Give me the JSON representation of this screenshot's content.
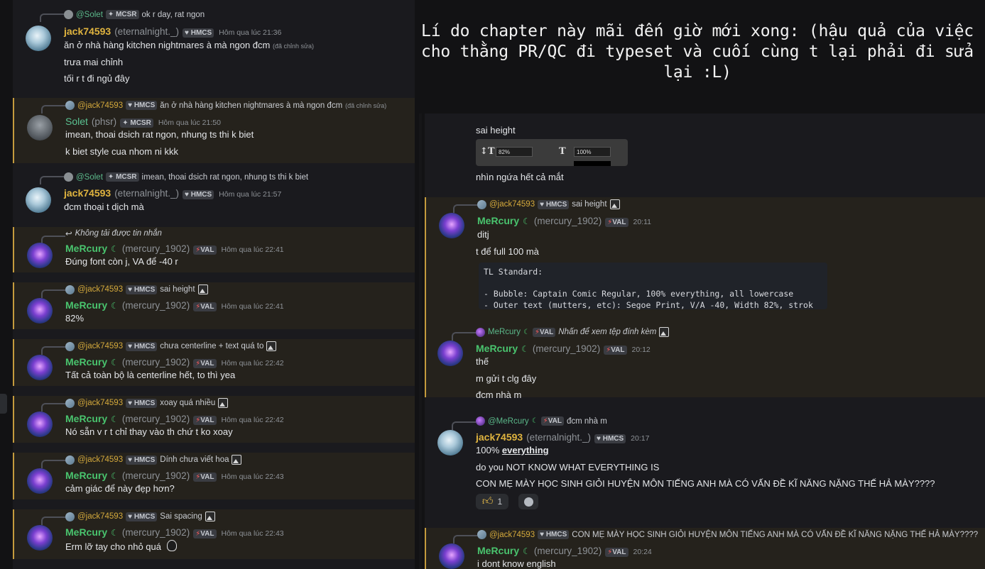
{
  "title": "Lí do chapter này mãi đến giờ mới xong: (hậu quả của việc cho thằng PR/QC đi typeset và cuối cùng t lại phải đi sửa lại :L)",
  "left_messages": [
    {
      "reply_name": "@Solet",
      "reply_tag": "MCSR",
      "reply_text": "ok r day, rat ngon",
      "author": "jack74593",
      "handle": "(eternalnight._)",
      "tag": "HMCS",
      "time": "Hôm qua lúc 21:36",
      "lines": [
        "ăn ở nhà hàng kitchen nightmares à mà ngon đcm",
        "trưa mai chỉnh",
        "tối r t đi ngủ đây"
      ],
      "edited": "(đã chỉnh sửa)"
    },
    {
      "reply_name": "@jack74593",
      "reply_tag": "HMCS",
      "reply_text": "ăn ở nhà hàng kitchen nightmares à mà ngon đcm",
      "reply_edited": "(đã chỉnh sửa)",
      "author": "Solet",
      "handle": "(phsr)",
      "tag": "MCSR",
      "time": "Hôm qua lúc 21:50",
      "lines": [
        "imean, thoai dsich rat ngon, nhung ts thi k biet",
        "k biet style cua nhom ni kkk"
      ]
    },
    {
      "reply_name": "@Solet",
      "reply_tag": "MCSR",
      "reply_text": "imean, thoai dsich rat ngon, nhung ts thi k biet",
      "author": "jack74593",
      "handle": "(eternalnight._)",
      "tag": "HMCS",
      "time": "Hôm qua lúc 21:57",
      "lines": [
        "đcm thoại t dịch mà"
      ]
    },
    {
      "reply_text": "Không tải được tin nhắn",
      "author": "MeRcury",
      "handle": "(mercury_1902)",
      "tag": "VAL",
      "time": "Hôm qua lúc 22:41",
      "lines": [
        "Đúng font còn j, VA để -40 r"
      ]
    },
    {
      "reply_name": "@jack74593",
      "reply_tag": "HMCS",
      "reply_text": "sai height",
      "author": "MeRcury",
      "handle": "(mercury_1902)",
      "tag": "VAL",
      "time": "Hôm qua lúc 22:41",
      "lines": [
        "82%"
      ]
    },
    {
      "reply_name": "@jack74593",
      "reply_tag": "HMCS",
      "reply_text": "chưa centerline + text quá to",
      "author": "MeRcury",
      "handle": "(mercury_1902)",
      "tag": "VAL",
      "time": "Hôm qua lúc 22:42",
      "lines": [
        "Tất cả toàn bộ là centerline hết, to thì yea"
      ]
    },
    {
      "reply_name": "@jack74593",
      "reply_tag": "HMCS",
      "reply_text": "xoay quá nhiều",
      "author": "MeRcury",
      "handle": "(mercury_1902)",
      "tag": "VAL",
      "time": "Hôm qua lúc 22:42",
      "lines": [
        "Nó sẵn v r t chỉ thay vào th chứ t ko xoay"
      ]
    },
    {
      "reply_name": "@jack74593",
      "reply_tag": "HMCS",
      "reply_text": "Dính chưa viết hoa",
      "author": "MeRcury",
      "handle": "(mercury_1902)",
      "tag": "VAL",
      "time": "Hôm qua lúc 22:43",
      "lines": [
        "cảm giác để này đẹp hơn?"
      ]
    },
    {
      "reply_name": "@jack74593",
      "reply_tag": "HMCS",
      "reply_text": "Sai spacing",
      "author": "MeRcury",
      "handle": "(mercury_1902)",
      "tag": "VAL",
      "time": "Hôm qua lúc 22:43",
      "lines": [
        "Erm lỡ tay cho nhỏ quá"
      ]
    }
  ],
  "right": {
    "top_lines": [
      "sai height",
      "nhìn ngứa hết cả mắt"
    ],
    "screenshot": {
      "val1": "82%",
      "val2": "100%"
    },
    "m1": {
      "reply_name": "@jack74593",
      "reply_tag": "HMCS",
      "reply_text": "sai height",
      "author": "MeRcury",
      "handle": "(mercury_1902)",
      "tag": "VAL",
      "time": "20:11",
      "lines": [
        "ditj",
        "t để full 100 mà"
      ]
    },
    "code": "TL Standard:\n\n- Bubble: Captain Comic Regular, 100% everything, all lowercase\n- Outer text (mutters, etc): Segoe Print, V/A -40, Width 82%, strok",
    "m2": {
      "reply_name": "MeRcury",
      "reply_tag": "VAL",
      "reply_text": "Nhấn để xem tệp đính kèm",
      "author": "MeRcury",
      "handle": "(mercury_1902)",
      "tag": "VAL",
      "time": "20:12",
      "lines": [
        "thế",
        "m gửi t clg đây",
        "đcm nhà m"
      ]
    },
    "m3": {
      "reply_name": "@MeRcury",
      "reply_tag": "VAL",
      "reply_text": "đcm nhà m",
      "author": "jack74593",
      "handle": "(eternalnight._)",
      "tag": "HMCS",
      "time": "20:17",
      "line1_prefix": "100% ",
      "line1_emph": "everything",
      "lines": [
        "do you NOT KNOW WHAT EVERYTHING IS",
        "CON MẸ MÀY HỌC SINH GIỎI HUYỆN MÔN TIẾNG ANH MÀ CÓ VẤN ĐỀ KĨ NĂNG NẶNG THẾ HẢ MÀY????"
      ],
      "reaction_count": "1"
    },
    "m4": {
      "reply_name": "@jack74593",
      "reply_tag": "HMCS",
      "reply_text": "CON MẸ MÀY HỌC SINH GIỎI HUYỆN MÔN TIẾNG ANH MÀ CÓ VẤN ĐỀ KĨ NĂNG NẶNG THẾ HẢ MÀY????",
      "author": "MeRcury",
      "handle": "(mercury_1902)",
      "tag": "VAL",
      "time": "20:24",
      "lines": [
        "i dont know english"
      ]
    }
  }
}
